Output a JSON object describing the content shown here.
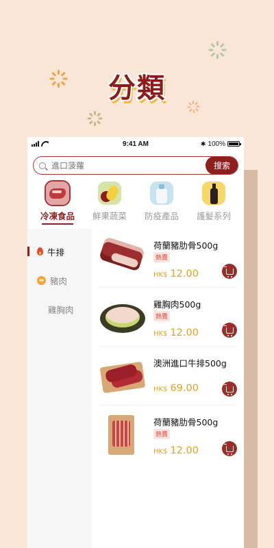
{
  "hero": {
    "title": "分類"
  },
  "status_bar": {
    "time": "9:41 AM",
    "battery": "100%"
  },
  "search": {
    "placeholder": "進口菠蘿",
    "button_label": "搜索"
  },
  "categories": [
    {
      "label": "冷凍食品",
      "icon": "frozen-meat-icon",
      "active": true
    },
    {
      "label": "鮮果蔬菜",
      "icon": "fruit-vegetable-icon",
      "active": false
    },
    {
      "label": "防疫產品",
      "icon": "sanitizer-icon",
      "active": false
    },
    {
      "label": "護髮系列",
      "icon": "hair-care-icon",
      "active": false
    }
  ],
  "side_nav": [
    {
      "label": "牛排",
      "icon": "fire-icon",
      "active": true
    },
    {
      "label": "豬肉",
      "icon": "pig-icon",
      "active": false
    },
    {
      "label": "雞胸肉",
      "icon": "",
      "active": false
    }
  ],
  "products": [
    {
      "name": "荷蘭豬肋骨500g",
      "badge": "熱賣",
      "currency": "HK$",
      "price": "12.00"
    },
    {
      "name": "雞胸肉500g",
      "badge": "熱賣",
      "currency": "HK$",
      "price": "12.00"
    },
    {
      "name": "澳洲進口牛排500g",
      "badge": "",
      "currency": "HK$",
      "price": "69.00"
    },
    {
      "name": "荷蘭豬肋骨500g",
      "badge": "熱賣",
      "currency": "HK$",
      "price": "12.00"
    }
  ],
  "colors": {
    "brand": "#8e1f1f",
    "price": "#e2a11e",
    "background": "#f9e6d6"
  }
}
